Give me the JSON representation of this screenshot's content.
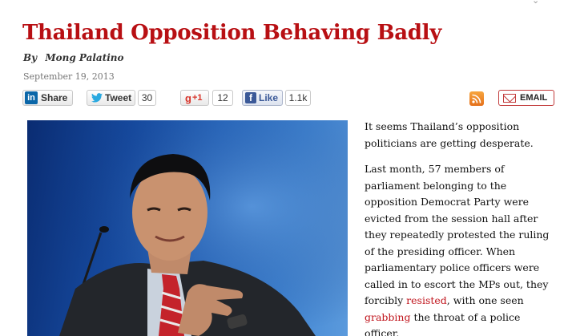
{
  "article": {
    "title": "Thailand Opposition Behaving Badly",
    "byline_prefix": "By",
    "author": "Mong Palatino",
    "date": "September 19, 2013"
  },
  "share": {
    "linkedin_label": "Share",
    "twitter_label": "Tweet",
    "twitter_count": "30",
    "gplus_label": "+1",
    "gplus_count": "12",
    "facebook_label": "Like",
    "facebook_count": "1.1k",
    "email_label": "EMAIL"
  },
  "photo": {
    "icon": "article-photo"
  },
  "body": {
    "p1": "It seems Thailand’s opposition politicians are getting desperate.",
    "p2_a": "Last month, 57 members of parliament belonging to the opposition Democrat Party were evicted from the session hall after they repeatedly protested the ruling of the presiding officer. When parliamentary police officers were called in to escort the MPs out, they forcibly ",
    "p2_link1": "resisted",
    "p2_b": ", with one seen ",
    "p2_link2": "grabbing",
    "p2_c": " the throat of a police officer."
  },
  "colors": {
    "title": "#b80f13",
    "link": "#c0141c",
    "linkedin": "#0a66a8",
    "twitter": "#2aa9e0",
    "facebook": "#3b5998",
    "rss": "#e5701b"
  }
}
